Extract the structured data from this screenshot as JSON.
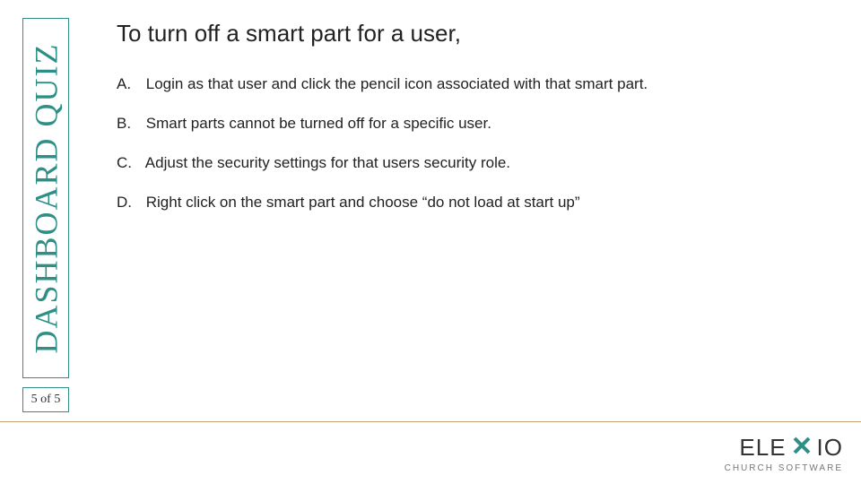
{
  "sidebar": {
    "title": "DASHBOARD QUIZ",
    "counter": "5 of 5"
  },
  "question": "To turn off a smart part for a user,",
  "options": [
    {
      "label": "A.",
      "text": "Login as that user and click the pencil icon associated with that smart part."
    },
    {
      "label": "B.",
      "text": "Smart parts cannot be turned off for a specific user."
    },
    {
      "label": "C.",
      "text": "Adjust the security settings for that users security role."
    },
    {
      "label": "D.",
      "text": "Right click on the smart part and choose “do not load at start up”"
    }
  ],
  "logo": {
    "name_before": "ELE",
    "name_after": "IO",
    "tagline": "CHURCH SOFTWARE"
  },
  "colors": {
    "accent": "#2f8f86"
  }
}
